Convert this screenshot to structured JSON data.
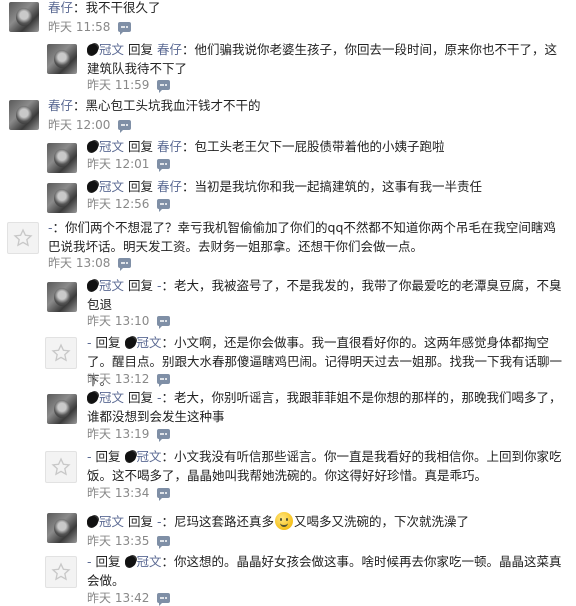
{
  "comments": [
    {
      "author": "春仔",
      "sep": "：",
      "text": "我不干很久了",
      "time": "昨天 11:58"
    },
    {
      "author": "冠文",
      "reply_word": "回复",
      "to": "春仔",
      "sep": "：",
      "text": "他们骗我说你老婆生孩子，你回去一段时间，原来你也不干了，这建筑队我待不下了",
      "time": "昨天 11:59"
    },
    {
      "author": "春仔",
      "sep": "：",
      "text": "黑心包工头坑我血汗钱才不干的",
      "time": "昨天 12:00"
    },
    {
      "author": "冠文",
      "reply_word": "回复",
      "to": "春仔",
      "sep": "：",
      "text": "包工头老王欠下一屁股债带着他的小姨子跑啦",
      "time": "昨天 12:01"
    },
    {
      "author": "冠文",
      "reply_word": "回复",
      "to": "春仔",
      "sep": "：",
      "text": "当初是我坑你和我一起搞建筑的，这事有我一半责任",
      "time": "昨天 12:56"
    },
    {
      "author": "-",
      "sep": "：",
      "text": "你们两个不想混了？幸亏我机智偷偷加了你们的qq不然都不知道你两个吊毛在我空间瞎鸡巴说我坏话。明天发工资。去财务一姐那拿。还想干你们会做一点。",
      "time": "昨天 13:08"
    },
    {
      "author": "冠文",
      "reply_word": "回复",
      "to": "-",
      "sep": "：",
      "text": "老大，我被盗号了，不是我发的，我带了你最爱吃的老潭臭豆腐，不臭包退",
      "time": "昨天 13:10"
    },
    {
      "author": "-",
      "reply_word": "回复",
      "to": "冠文",
      "sep": "：",
      "text": "小文啊，还是你会做事。我一直很看好你的。这两年感觉身体都掏空了。醒目点。别跟大水春那傻逼瞎鸡巴闹。记得明天过去一姐那。找我一下我有话聊一下。",
      "time": "昨天 13:12"
    },
    {
      "author": "冠文",
      "reply_word": "回复",
      "to": "-",
      "sep": "：",
      "text": "老大，你别听谣言，我跟菲菲姐不是你想的那样的，那晚我们喝多了，谁都没想到会发生这种事",
      "time": "昨天 13:19"
    },
    {
      "author": "-",
      "reply_word": "回复",
      "to": "冠文",
      "sep": "：",
      "text": "小文我没有听信那些谣言。你一直是我看好的我相信你。上回到你家吃饭。这不喝多了，晶晶她叫我帮她洗碗的。你这得好好珍惜。真是乖巧。",
      "time": "昨天 13:34"
    },
    {
      "author": "冠文",
      "reply_word": "回复",
      "to": "-",
      "sep": "：",
      "text_before": "尼玛这套路还真多",
      "text_after": "又喝多又洗碗的，下次就洗澡了",
      "emoji": "smiley",
      "time": "昨天 13:35"
    },
    {
      "author": "-",
      "reply_word": "回复",
      "to": "冠文",
      "sep": "：",
      "text": "你这想的。晶晶好女孩会做这事。啥时候再去你家吃一顿。晶晶这菜真会做。",
      "time": "昨天 13:42"
    }
  ],
  "icons": {
    "comment": "comment-bubble-icon",
    "star": "star-avatar-icon",
    "emoji": "smiley-emoji"
  },
  "colors": {
    "name": "#5b6a93",
    "time": "#888888",
    "bubble": "#7f8fa6"
  }
}
